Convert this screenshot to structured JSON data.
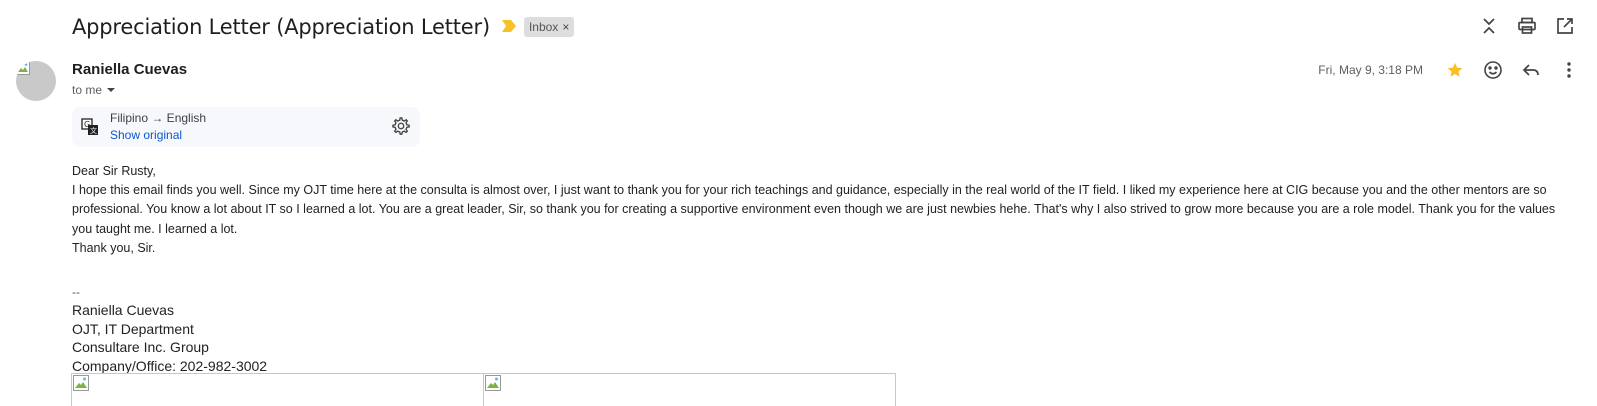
{
  "email": {
    "subject": "Appreciation Letter (Appreciation Letter)",
    "label": "Inbox",
    "label_remove": "×",
    "sender": "Raniella Cuevas",
    "recipient": "to me",
    "date": "Fri, May 9, 3:18 PM"
  },
  "translation": {
    "languages": "Filipino → English",
    "show_original": "Show original"
  },
  "body": {
    "greeting": "Dear Sir Rusty,",
    "paragraph": "I hope this email finds you well. Since my OJT time here at the consulta is almost over, I just want to thank you for your rich teachings and guidance, especially in the real world of the IT field. I liked my experience here at CIG because you and the other mentors are so professional. You know a lot about IT so I learned a lot. You are a great leader, Sir, so thank you for creating a supportive environment even though we are just newbies hehe. That's why I also strived to grow more because you are a role model. Thank you for the values you taught me. I learned a lot.",
    "closing": "Thank you, Sir."
  },
  "signature": {
    "dashes": "--",
    "name": "Raniella Cuevas",
    "title": "OJT, IT Department",
    "company": "Consultare Inc. Group",
    "phone": "Company/Office: 202-982-3002"
  },
  "icons": {
    "collapse": "collapse-all-icon",
    "print": "print-icon",
    "open_new_window": "open-in-new-window-icon",
    "star": "star-icon",
    "emoji": "emoji-react-icon",
    "reply": "reply-icon",
    "more": "more-vert-icon",
    "translate": "translate-icon",
    "settings": "gear-icon"
  },
  "colors": {
    "importance_marker": "#f6c026",
    "star": "#f6c026",
    "link": "#0b57d0",
    "chip_bg": "#dddddd"
  }
}
